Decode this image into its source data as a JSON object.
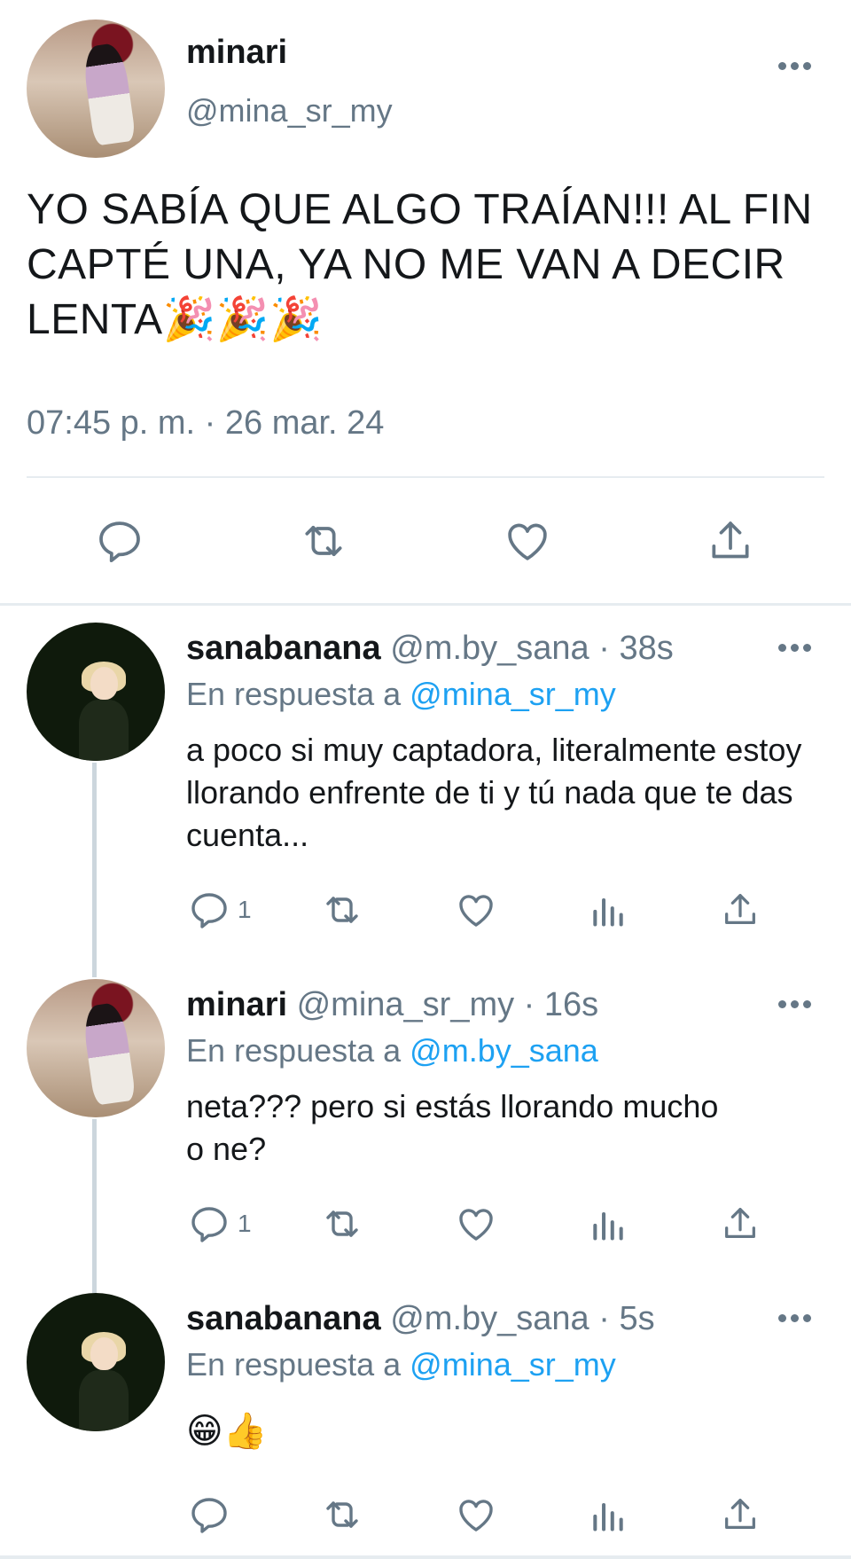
{
  "main_tweet": {
    "name": "minari",
    "handle": "@mina_sr_my",
    "text": "YO SABÍA QUE ALGO TRAÍAN!!! AL FIN CAPTÉ UNA, YA NO ME VAN A DECIR LENTA🎉🎉🎉",
    "timestamp": "07:45 p. m. · 26 mar. 24",
    "actions": [
      "reply-icon",
      "retweet-icon",
      "like-icon",
      "share-icon"
    ]
  },
  "replies": [
    {
      "name": "sanabanana",
      "meta": "@m.by_sana · 38s",
      "reply_prefix": "En respuesta a ",
      "reply_to": "@mina_sr_my",
      "text": "a poco si muy captadora, literalmente estoy llorando enfrente de ti y tú nada que te das cuenta...",
      "reply_count": "1"
    },
    {
      "name": "minari",
      "meta": "@mina_sr_my · 16s",
      "reply_prefix": "En respuesta a ",
      "reply_to": "@m.by_sana",
      "text": "neta??? pero si estás llorando mucho o ne?",
      "reply_count": "1"
    },
    {
      "name": "sanabanana",
      "meta": "@m.by_sana · 5s",
      "reply_prefix": "En respuesta a ",
      "reply_to": "@mina_sr_my",
      "text": "😁👍",
      "reply_count": ""
    }
  ],
  "colors": {
    "text": "#14171a",
    "secondary": "#657786",
    "link": "#1da1f2",
    "divider": "#e6ecf0",
    "thread_line": "#ccd6dd"
  }
}
